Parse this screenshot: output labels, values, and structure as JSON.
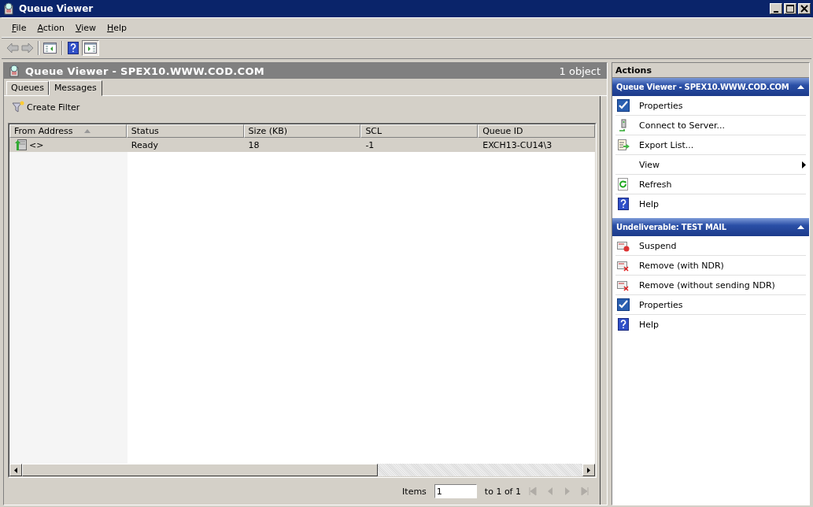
{
  "window": {
    "title": "Queue Viewer"
  },
  "menu": [
    "File",
    "Action",
    "View",
    "Help"
  ],
  "pane": {
    "title": "Queue Viewer - SPEX10.WWW.COD.COM",
    "count": "1 object"
  },
  "tabs": [
    {
      "label": "Queues",
      "selected": false
    },
    {
      "label": "Messages",
      "selected": true
    }
  ],
  "filter_button": "Create Filter",
  "table": {
    "columns": [
      {
        "label": "From Address",
        "sorted": true
      },
      {
        "label": "Status",
        "sorted": false
      },
      {
        "label": "Size (KB)",
        "sorted": false
      },
      {
        "label": "SCL",
        "sorted": false
      },
      {
        "label": "Queue ID",
        "sorted": false
      }
    ],
    "rows": [
      {
        "cells": [
          "<>",
          "Ready",
          "18",
          "-1",
          "EXCH13-CU14\\3"
        ],
        "selected": true
      }
    ]
  },
  "pager": {
    "label": "Items",
    "value": "1",
    "range": "to 1 of 1"
  },
  "actions": {
    "title": "Actions",
    "sections": [
      {
        "title": "Queue Viewer - SPEX10.WWW.COD.COM",
        "expanded": true,
        "items": [
          {
            "label": "Properties",
            "kind": "check"
          },
          {
            "label": "Connect to Server...",
            "kind": "server"
          },
          {
            "label": "Export List...",
            "kind": "export"
          },
          {
            "label": "View",
            "kind": "submenu"
          },
          {
            "label": "Refresh",
            "kind": "refresh"
          },
          {
            "label": "Help",
            "kind": "help"
          }
        ]
      },
      {
        "title": "Undeliverable: TEST MAIL",
        "expanded": true,
        "items": [
          {
            "label": "Suspend",
            "kind": "suspend"
          },
          {
            "label": "Remove (with NDR)",
            "kind": "remove"
          },
          {
            "label": "Remove (without sending NDR)",
            "kind": "remove"
          },
          {
            "label": "Properties",
            "kind": "check"
          },
          {
            "label": "Help",
            "kind": "help"
          }
        ]
      }
    ]
  }
}
